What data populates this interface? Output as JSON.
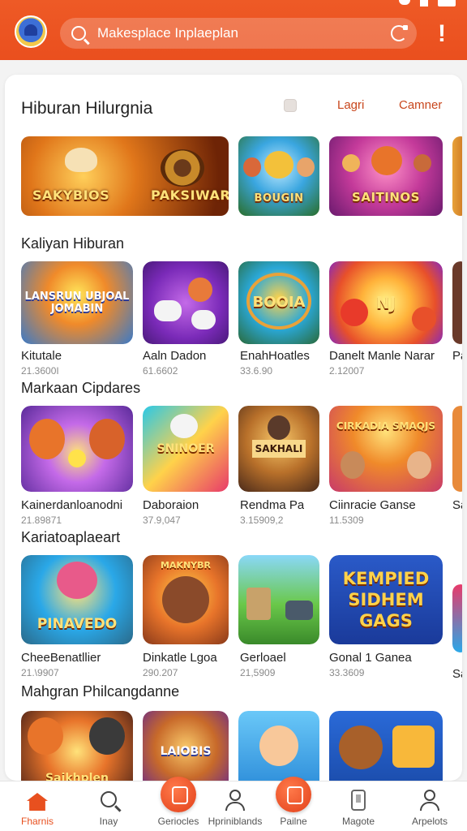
{
  "header": {
    "search_placeholder": "Makesplace Inplaeplan",
    "alert_glyph": "!",
    "colors": {
      "bar": "#ea4f1e",
      "accent": "#e8501f"
    }
  },
  "featured": {
    "title": "Hiburan Hilurgnia",
    "link_lagri": "Lagri",
    "link_camner": "Camner",
    "banners": [
      {
        "text": "SAKYBIOS",
        "icon": "treasure-icon"
      },
      {
        "text": "PAKSIWAR",
        "icon": "arrow-icon"
      },
      {
        "text": "BOUGIN",
        "icon": "cartoon-characters"
      },
      {
        "text": "SAITINOS",
        "icon": "fox-character"
      }
    ]
  },
  "sections": [
    {
      "title": "Kaliyan Hiburan",
      "games": [
        {
          "name": "Kitutale",
          "count": "21.3600I",
          "thumb_text": "LANSRUN UBJOAL JOMABIN"
        },
        {
          "name": "Aaln Dadon",
          "count": "61.6602",
          "thumb_text": ""
        },
        {
          "name": "EnahHoatles",
          "count": "33.6.90",
          "thumb_text": "BOOIA"
        },
        {
          "name": "Danelt Manle Narar",
          "count": "2.12007",
          "thumb_text": "NJ"
        },
        {
          "name": "Pa",
          "count": "",
          "thumb_text": ""
        }
      ]
    },
    {
      "title": "Markaan Cipdares",
      "games": [
        {
          "name": "Kainerdanloanodni",
          "count": "21.89871",
          "thumb_text": ""
        },
        {
          "name": "Daboraion",
          "count": "37.9,047",
          "thumb_text": "SNINOER"
        },
        {
          "name": "Rendma Pa",
          "count": "3.15909,2",
          "thumb_text": "SAKHALI"
        },
        {
          "name": "Ciinracie Ganse",
          "count": "11.5309",
          "thumb_text": "CIRKADIA SMAQJS"
        },
        {
          "name": "Sa",
          "count": "",
          "thumb_text": ""
        }
      ]
    },
    {
      "title": "Kariatoaplaeart",
      "games": [
        {
          "name": "CheeBenatllier",
          "count": "21.\\9907",
          "thumb_text": "PINAVEDO"
        },
        {
          "name": "Dinkatle Lgoa",
          "count": "290.207",
          "thumb_text": "MAKNYBR"
        },
        {
          "name": "Gerloael",
          "count": "21,5909",
          "thumb_text": ""
        },
        {
          "name": "Gonal 1 Ganea",
          "count": "33.3609",
          "thumb_text": "KEMPIED SIDHEM GAGS"
        },
        {
          "name": "Sa",
          "count": "",
          "thumb_text": ""
        }
      ]
    },
    {
      "title": "Mahgran Philcangdanne",
      "games": [
        {
          "name": "",
          "count": "",
          "thumb_text": "Saikhplen"
        },
        {
          "name": "",
          "count": "",
          "thumb_text": "LAIOBIS"
        },
        {
          "name": "",
          "count": "",
          "thumb_text": ""
        },
        {
          "name": "",
          "count": "",
          "thumb_text": ""
        }
      ]
    }
  ],
  "bottom_nav": [
    {
      "label": "Fharnis",
      "icon": "home-icon",
      "active": true
    },
    {
      "label": "Inay",
      "icon": "search-icon",
      "active": false
    },
    {
      "label": "Geriocles",
      "icon": "bubble-icon",
      "active": false
    },
    {
      "label": "Hpriniblands",
      "icon": "person-icon",
      "active": false
    },
    {
      "label": "Pailne",
      "icon": "bubble-icon",
      "active": false
    },
    {
      "label": "Magote",
      "icon": "phone-icon",
      "active": false
    },
    {
      "label": "Arpelots",
      "icon": "person-icon",
      "active": false
    }
  ]
}
